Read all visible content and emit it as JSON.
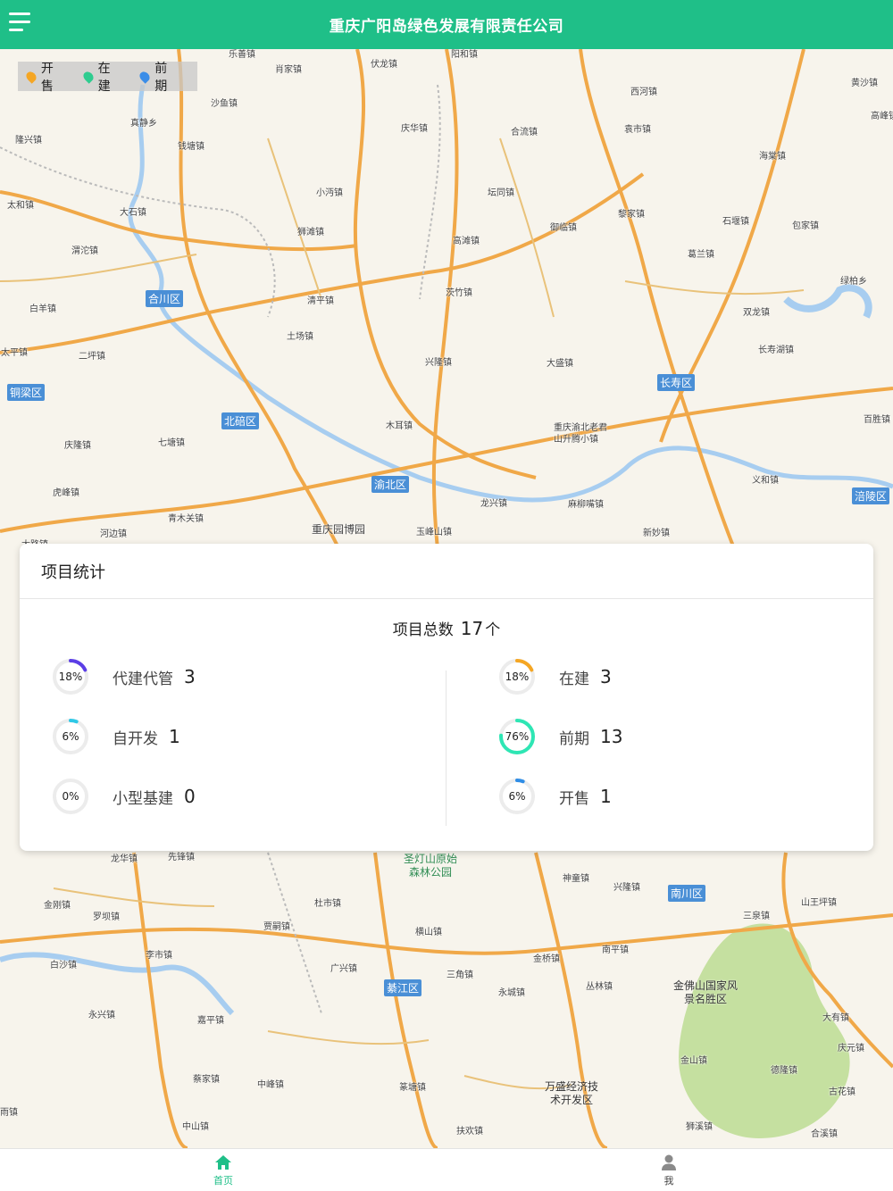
{
  "header": {
    "title": "重庆广阳岛绿色发展有限责任公司"
  },
  "legend": [
    {
      "label": "开售",
      "color": "#f5a623"
    },
    {
      "label": "在建",
      "color": "#2ecc8f"
    },
    {
      "label": "前期",
      "color": "#3a8de8"
    }
  ],
  "map": {
    "places": [
      "乐善镇",
      "肖家镇",
      "伏龙镇",
      "阳和镇",
      "沙鱼镇",
      "真静乡",
      "钱塘镇",
      "庆华镇",
      "合流镇",
      "西河镇",
      "黄沙镇",
      "高峰镇",
      "隆兴镇",
      "小沔镇",
      "坛同镇",
      "袁市镇",
      "海棠镇",
      "太和镇",
      "大石镇",
      "狮滩镇",
      "高滩镇",
      "黎家镇",
      "御临镇",
      "石堰镇",
      "包家镇",
      "渭沱镇",
      "茨竹镇",
      "葛兰镇",
      "绿柏乡",
      "白羊镇",
      "清平镇",
      "双龙镇",
      "土场镇",
      "长寿湖镇",
      "太平镇",
      "二坪镇",
      "兴隆镇",
      "大盛镇",
      "七塘镇",
      "庆隆镇",
      "木耳镇",
      "重庆渝北老君山升腾小镇",
      "百胜镇",
      "虎峰镇",
      "龙兴镇",
      "麻柳嘴镇",
      "义和镇",
      "青木关镇",
      "河边镇",
      "玉峰山镇",
      "新妙镇",
      "大路镇",
      "重庆园博园",
      "龙华镇",
      "先锋镇",
      "金刚镇",
      "罗坝镇",
      "杜市镇",
      "贾嗣镇",
      "神童镇",
      "兴隆镇",
      "三泉镇",
      "山王坪镇",
      "白沙镇",
      "横山镇",
      "南平镇",
      "李市镇",
      "广兴镇",
      "三角镇",
      "金桥镇",
      "永兴镇",
      "嘉平镇",
      "永城镇",
      "丛林镇",
      "大有镇",
      "庆元镇",
      "金山镇",
      "德隆镇",
      "蔡家镇",
      "中峰镇",
      "篆塘镇",
      "古花镇",
      "雨镇",
      "中山镇",
      "扶欢镇",
      "狮溪镇",
      "合溪镇"
    ],
    "districts": [
      "合川区",
      "铜梁区",
      "北碚区",
      "渝北区",
      "长寿区",
      "涪陵区",
      "綦江区",
      "南川区"
    ],
    "pois": [
      {
        "name": "圣灯山原始森林公园"
      },
      {
        "name": "金佛山国家风景名胜区"
      },
      {
        "name": "万盛经济技术开发区"
      }
    ]
  },
  "stats": {
    "title": "项目统计",
    "total_label": "项目总数",
    "total_value": "17",
    "total_unit": "个",
    "left": [
      {
        "label": "代建代管",
        "value": "3",
        "percent": 18,
        "percent_text": "18%",
        "color": "#5b3ee6"
      },
      {
        "label": "自开发",
        "value": "1",
        "percent": 6,
        "percent_text": "6%",
        "color": "#2fc8e6"
      },
      {
        "label": "小型基建",
        "value": "0",
        "percent": 0,
        "percent_text": "0%",
        "color": "#999999"
      }
    ],
    "right": [
      {
        "label": "在建",
        "value": "3",
        "percent": 18,
        "percent_text": "18%",
        "color": "#f5a623"
      },
      {
        "label": "前期",
        "value": "13",
        "percent": 76,
        "percent_text": "76%",
        "color": "#2ee6b4"
      },
      {
        "label": "开售",
        "value": "1",
        "percent": 6,
        "percent_text": "6%",
        "color": "#2f8de6"
      }
    ]
  },
  "tabbar": {
    "home_label": "首页",
    "me_label": "我",
    "active_color": "#1fbf88"
  }
}
